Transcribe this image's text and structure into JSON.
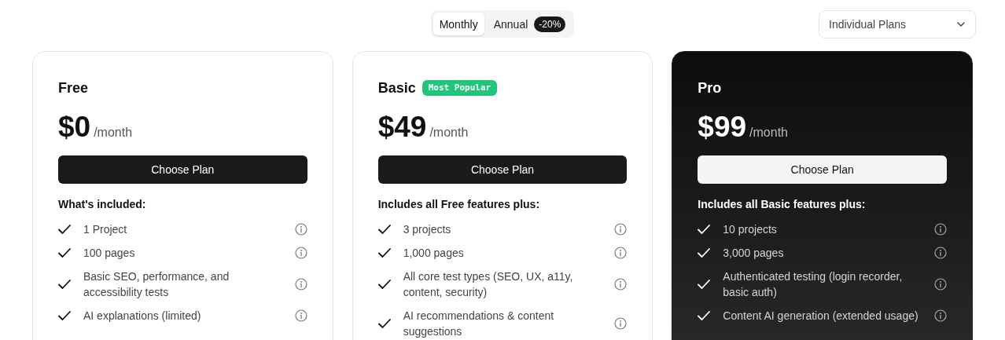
{
  "billing_toggle": [
    {
      "label": "Monthly",
      "selected": true
    },
    {
      "label": "Annual",
      "selected": false,
      "badge": "-20%"
    }
  ],
  "plan_type_select": {
    "value": "Individual Plans"
  },
  "plans": [
    {
      "name": "Free",
      "kind": "light",
      "price": "$0",
      "period": "/month",
      "button": "Choose Plan",
      "features_heading": "What's included:",
      "features": [
        "1 Project",
        "100 pages",
        "Basic SEO, performance, and accessibility tests",
        "AI explanations (limited)"
      ]
    },
    {
      "name": "Basic",
      "kind": "light",
      "badge": "Most Popular",
      "price": "$49",
      "period": "/month",
      "button": "Choose Plan",
      "features_heading": "Includes all Free features plus:",
      "features": [
        "3 projects",
        "1,000 pages",
        "All core test types (SEO, UX, a11y, content, security)",
        "AI recommendations & content suggestions"
      ]
    },
    {
      "name": "Pro",
      "kind": "dark",
      "price": "$99",
      "period": "/month",
      "button": "Choose Plan",
      "features_heading": "Includes all Basic features plus:",
      "features": [
        "10 projects",
        "3,000 pages",
        "Authenticated testing (login recorder, basic auth)",
        "Content AI generation (extended usage)"
      ]
    }
  ]
}
